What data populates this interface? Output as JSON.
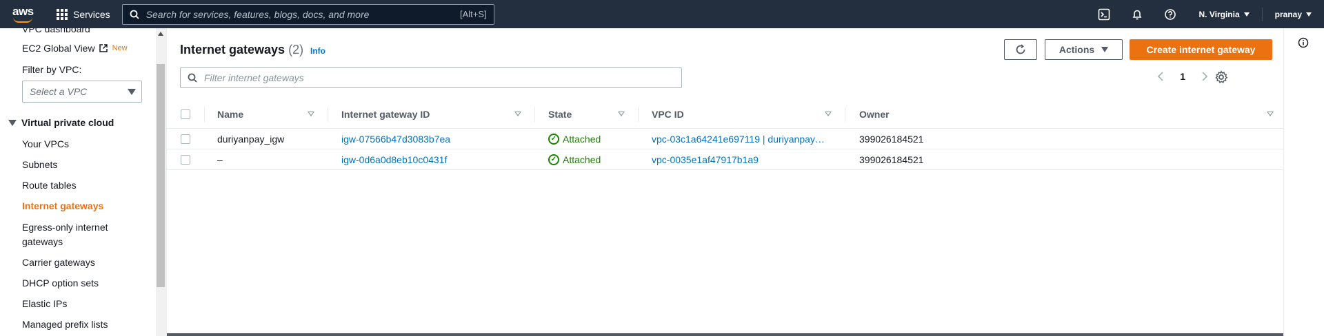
{
  "topnav": {
    "logo_text": "aws",
    "services_label": "Services",
    "search_placeholder": "Search for services, features, blogs, docs, and more",
    "search_shortcut": "[Alt+S]",
    "region": "N. Virginia",
    "user": "pranay"
  },
  "sidebar": {
    "cut_item": "VPC dashboard",
    "ec2_global_view": "EC2 Global View",
    "new_badge": "New",
    "filter_label": "Filter by VPC:",
    "select_placeholder": "Select a VPC",
    "section": "Virtual private cloud",
    "items": [
      "Your VPCs",
      "Subnets",
      "Route tables",
      "Internet gateways",
      "Egress-only internet",
      "gateways",
      "Carrier gateways",
      "DHCP option sets",
      "Elastic IPs",
      "Managed prefix lists"
    ]
  },
  "main": {
    "title": "Internet gateways",
    "count": "(2)",
    "info": "Info",
    "actions_label": "Actions",
    "create_label": "Create internet gateway",
    "filter_placeholder": "Filter internet gateways",
    "page": "1",
    "columns": [
      "Name",
      "Internet gateway ID",
      "State",
      "VPC ID",
      "Owner"
    ],
    "rows": [
      {
        "name": "duriyanpay_igw",
        "id": "igw-07566b47d3083b7ea",
        "state": "Attached",
        "vpc": "vpc-03c1a64241e697119 | duriyanpay…",
        "owner": "399026184521"
      },
      {
        "name": "–",
        "id": "igw-0d6a0d8eb10c0431f",
        "state": "Attached",
        "vpc": "vpc-0035e1af47917b1a9",
        "owner": "399026184521"
      }
    ]
  },
  "colors": {
    "nav_bg": "#232f3e",
    "accent_orange": "#ec7211",
    "link_blue": "#0073bb",
    "success_green": "#1d8102"
  }
}
